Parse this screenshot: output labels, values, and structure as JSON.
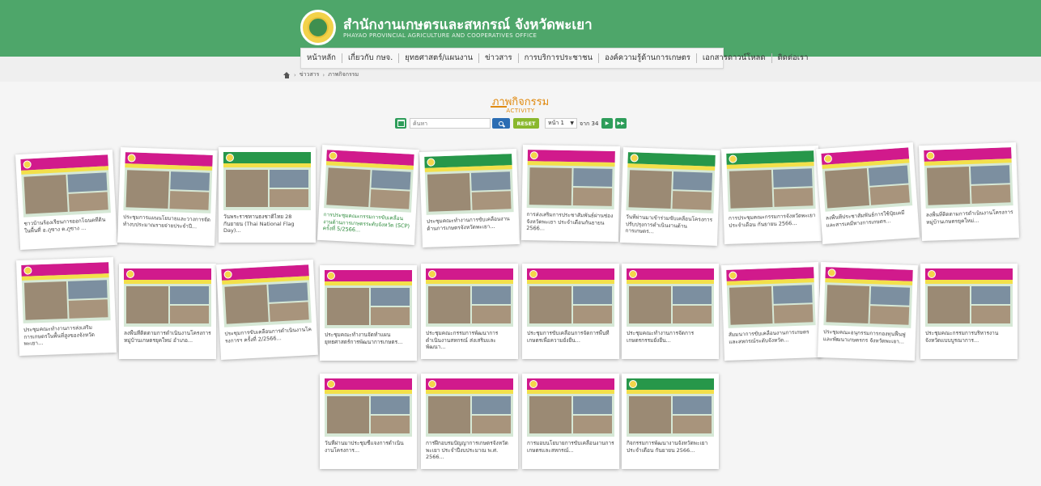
{
  "header": {
    "title": "สำนักงานเกษตรและสหกรณ์ จังหวัดพะเยา",
    "subtitle": "PHAYAO PROVINCIAL AGRICULTURE AND COOPERATIVES OFFICE"
  },
  "nav": {
    "items": [
      "หน้าหลัก",
      "เกี่ยวกับ กษจ.",
      "ยุทธศาสตร์/แผนงาน",
      "ข่าวสาร",
      "การบริการประชาชน",
      "องค์ความรู้ด้านการเกษตร",
      "เอกสารดาวน์โหลด",
      "ติดต่อเรา"
    ]
  },
  "breadcrumb": {
    "items": [
      "ข่าวสาร",
      "ภาพกิจกรรม"
    ]
  },
  "page": {
    "title": "ภาพกิจกรรม",
    "subtitle": "ACTIVITY"
  },
  "search": {
    "placeholder": "ค้นหา",
    "reset_label": "RESET",
    "page_select": "หน้า 1",
    "of_text": "จาก 34"
  },
  "cards": [
    {
      "caption": "ชาวบ้านร้องเรียนการออกโฉนดที่ดินในพื้นที่ อ.ภูซาง ต.ภูซาง ..."
    },
    {
      "caption": "ประชุมการแผนนโยบายและวางการจัดทำงบประมาณรายจ่ายประจำปี..."
    },
    {
      "caption": "วันพระราชทานธงชาติไทย 28 กันยายน (Thai National Flag Day)..."
    },
    {
      "caption": "การประชุมคณะกรรมการขับเคลื่อนงานด้านการเกษตรระดับจังหวัด (SCP) ครั้งที่ 5/2566..."
    },
    {
      "caption": "ประชุมคณะทำงานการขับเคลื่อนงานด้านการเกษตรจังหวัดพะเยา..."
    },
    {
      "caption": "การส่งเสริมการประชาสัมพันธ์ผ่านช่องจังหวัดพะเยา ประจำเดือนกันยายน 2566..."
    },
    {
      "caption": "วันที่ผ่านมาเข้าร่วมขับเคลื่อนโครงการ ปรับปรุงการดำเนินงานด้านการเกษตร..."
    },
    {
      "caption": "การประชุมคณะกรรมการจังหวัดพะเยา ประจำเดือน กันยายน 2566..."
    },
    {
      "caption": "ลงพื้นที่ประชาสัมพันธ์การใช้ปุ๋ยเคมีและสารเคมีทางการเกษตร..."
    },
    {
      "caption": "ลงพื้นที่ติดตามการดำเนินงานโครงการหมู่บ้านเกษตรยุคใหม่..."
    },
    {
      "caption": "ประชุมคณะทำงานการส่งเสริมการเกษตรในพื้นที่สูงของจังหวัดพะเยา..."
    },
    {
      "caption": "ลงพื้นที่ติดตามการดำเนินงานโครงการหมู่บ้านเกษตรยุคใหม่ อำเภอ..."
    },
    {
      "caption": "ประชุมการขับเคลื่อนการดำเนินงานโครงการฯ ครั้งที่ 2/2566..."
    },
    {
      "caption": "ประชุมคณะทำงานจัดทำแผนยุทธศาสตร์การพัฒนาการเกษตร..."
    },
    {
      "caption": "ประชุมคณะกรรมการพัฒนาการดำเนินงานสหกรณ์ ส่งเสริมและพัฒนา..."
    },
    {
      "caption": "ประชุมการขับเคลื่อนการจัดการพื้นที่เกษตรเพื่อความยั่งยืน..."
    },
    {
      "caption": "ประชุมคณะทำงานการจัดการเกษตรกรรมยั่งยืน..."
    },
    {
      "caption": "สัมมนาการขับเคลื่อนงานการเกษตรและสหกรณ์ระดับจังหวัด..."
    },
    {
      "caption": "ประชุมคณะอนุกรรมการกองทุนฟื้นฟูและพัฒนาเกษตรกร จังหวัดพะเยา..."
    },
    {
      "caption": "ประชุมคณะกรรมการบริหารงานจังหวัดแบบบูรณาการ..."
    },
    {
      "caption": "วันที่ผ่านมาประชุมชี้แจงการดำเนินงานโครงการ..."
    },
    {
      "caption": "การฝึกอบรมปัญญาการเกษตรจังหวัดพะเยา ประจำปีงบประมาณ พ.ศ. 2566..."
    },
    {
      "caption": "การมอบนโยบายการขับเคลื่อนงานการเกษตรและสหกรณ์..."
    },
    {
      "caption": "กิจกรรมการพัฒนางานจังหวัดพะเยา ประจำเดือน กันยายน 2566..."
    }
  ],
  "colors": {
    "header_green": "#4ea66a",
    "accent_orange": "#e08a10",
    "banner_magenta": "#d11a8c"
  }
}
